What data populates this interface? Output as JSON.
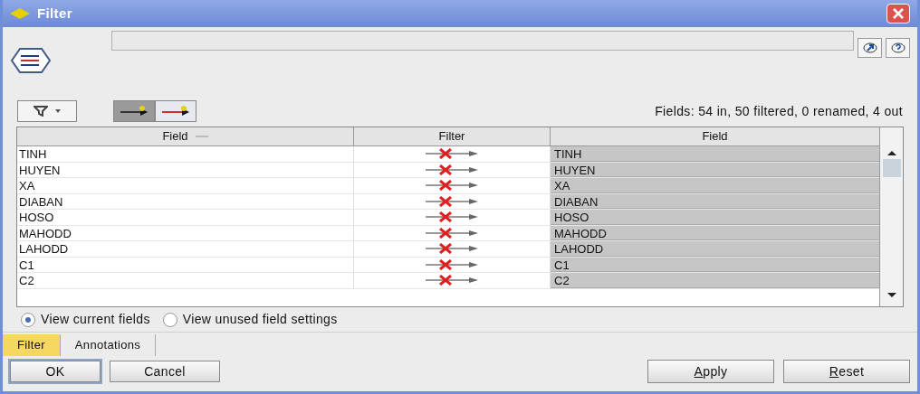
{
  "window": {
    "title": "Filter"
  },
  "status": "Fields: 54 in, 50 filtered, 0 renamed, 4 out",
  "toggles": [
    {
      "selected": true
    },
    {
      "selected": false
    }
  ],
  "table": {
    "columns": [
      "Field",
      "Filter",
      "Field"
    ],
    "rows": [
      {
        "input": "TINH",
        "filtered": true,
        "output": "TINH"
      },
      {
        "input": "HUYEN",
        "filtered": true,
        "output": "HUYEN"
      },
      {
        "input": "XA",
        "filtered": true,
        "output": "XA"
      },
      {
        "input": "DIABAN",
        "filtered": true,
        "output": "DIABAN"
      },
      {
        "input": "HOSO",
        "filtered": true,
        "output": "HOSO"
      },
      {
        "input": "MAHODD",
        "filtered": true,
        "output": "MAHODD"
      },
      {
        "input": "LAHODD",
        "filtered": true,
        "output": "LAHODD"
      },
      {
        "input": "C1",
        "filtered": true,
        "output": "C1"
      },
      {
        "input": "C2",
        "filtered": true,
        "output": "C2"
      }
    ]
  },
  "view_options": [
    {
      "label": "View current fields",
      "selected": true
    },
    {
      "label": "View unused field settings",
      "selected": false
    }
  ],
  "tabs": [
    {
      "label": "Filter",
      "selected": true
    },
    {
      "label": "Annotations",
      "selected": false
    }
  ],
  "buttons_left": [
    "OK",
    "Cancel"
  ],
  "buttons_right": [
    "Apply",
    "Reset"
  ]
}
